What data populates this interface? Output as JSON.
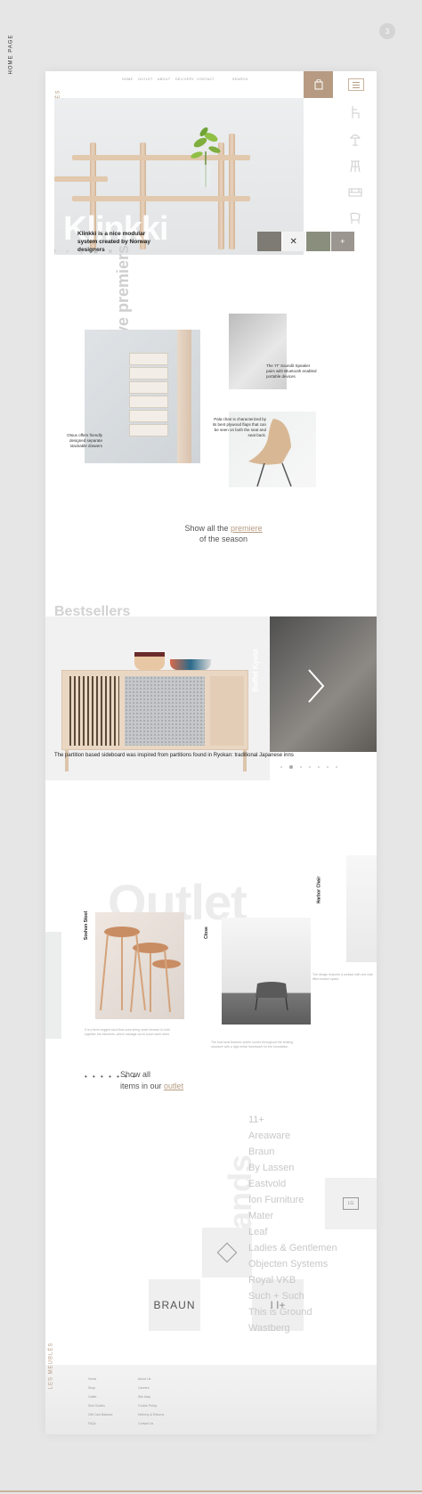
{
  "page_label": "HOME PAGE",
  "page_number": "3",
  "brand": "LES MEUBLÉS",
  "nav": {
    "items": [
      "HOME",
      "OUTLET",
      "ABOUT",
      "DELIVERY",
      "CONTACT"
    ],
    "search": "SEARCH"
  },
  "hero": {
    "title": "Klinkki",
    "subtitle": "Klinkki is a nice modular system created by Norway designers"
  },
  "premieres": {
    "title": "Our exclusive premiers",
    "caption_a": "Otsus offers friendly designed separate stackable drawers",
    "caption_b": "The 'IT' Soundit Speaker pairs with Bluetooth enabled portable devices",
    "caption_c": "Pala chair is characterized by its bent plywood flaps that can be seen on both the seat and seat back.",
    "cta_prefix": "Show all the",
    "cta_link": "premiere",
    "cta_suffix": "of the season"
  },
  "bestsellers": {
    "title": "Bestsellers",
    "caption": "The partition based sideboard was inspired from partitions found in Ryokan: traditional Japanese inns",
    "side_label": "Buffet Kyoto"
  },
  "outlet": {
    "bg_title": "Outlet",
    "products": [
      {
        "name": "Soshon Stool",
        "desc": "It is a three-legged stool that uses string under tension to hold together the elements, which manage not to touch each other."
      },
      {
        "name": "Close",
        "desc": "The bow seat features subtle curves throughout the seating structure with a rigid metal framework for the foundation."
      },
      {
        "name": "Harbor Chair",
        "desc": "The design features a surface with one side lifted drawer space."
      }
    ],
    "cta_prefix": "Show all",
    "cta_mid": "items in our",
    "cta_link": "outlet"
  },
  "brands": {
    "bg_title": "Brands",
    "list": [
      "11+",
      "Areaware",
      "Braun",
      "By Lassen",
      "Eastvold",
      "Ion Furniture",
      "Mater",
      "Leaf",
      "Ladies & Gentlemen",
      "Objecten Systems",
      "Royal VKB",
      "Such + Such",
      "This is Ground",
      "Wastberg"
    ],
    "logo_braun": "BRAUN"
  },
  "footer": {
    "col1": [
      "Home",
      "Shop",
      "Outlet",
      "Size Guides",
      "Gift Card Balance",
      "FAQs"
    ],
    "col2": [
      "About Us",
      "Careers",
      "Site Map",
      "Cookie Policy",
      "Delivery & Returns",
      "Contact Us"
    ]
  },
  "colors": {
    "accent": "#b69b82",
    "muted": "#cfcfcf"
  },
  "icons": [
    "shopping-bag-icon",
    "menu-icon",
    "chair-icon",
    "lamp-icon",
    "stool-icon",
    "bed-icon",
    "sofa-icon"
  ]
}
